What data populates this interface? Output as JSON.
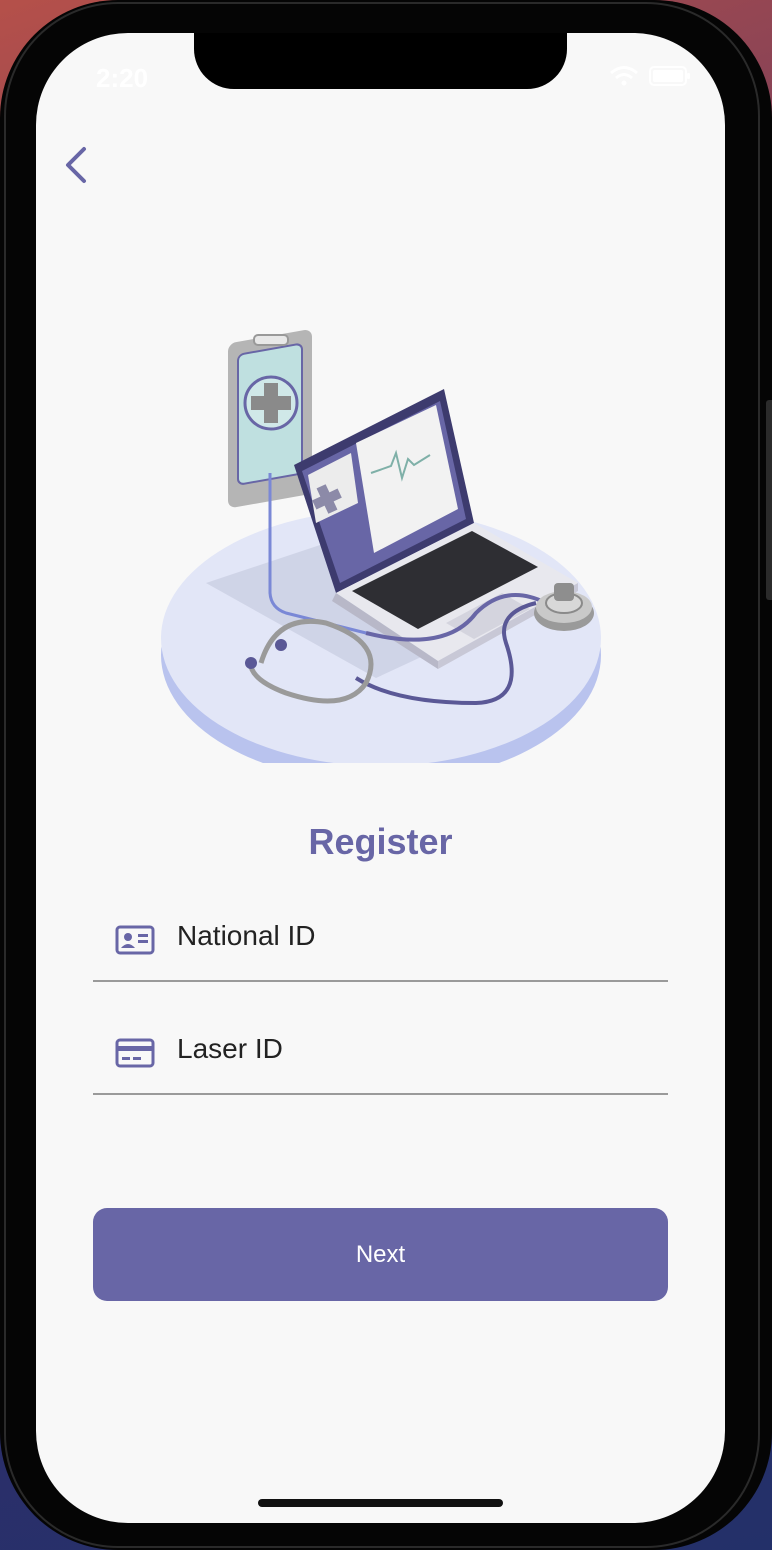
{
  "status_bar": {
    "time": "2:20"
  },
  "screen": {
    "title": "Register",
    "fields": [
      {
        "label": "National ID",
        "icon": "id-card-icon"
      },
      {
        "label": "Laser ID",
        "icon": "credit-card-icon"
      }
    ],
    "next_label": "Next"
  },
  "colors": {
    "accent": "#6866a6",
    "background": "#f8f8f8"
  },
  "illustration": "medical-laptop-stethoscope-illustration"
}
